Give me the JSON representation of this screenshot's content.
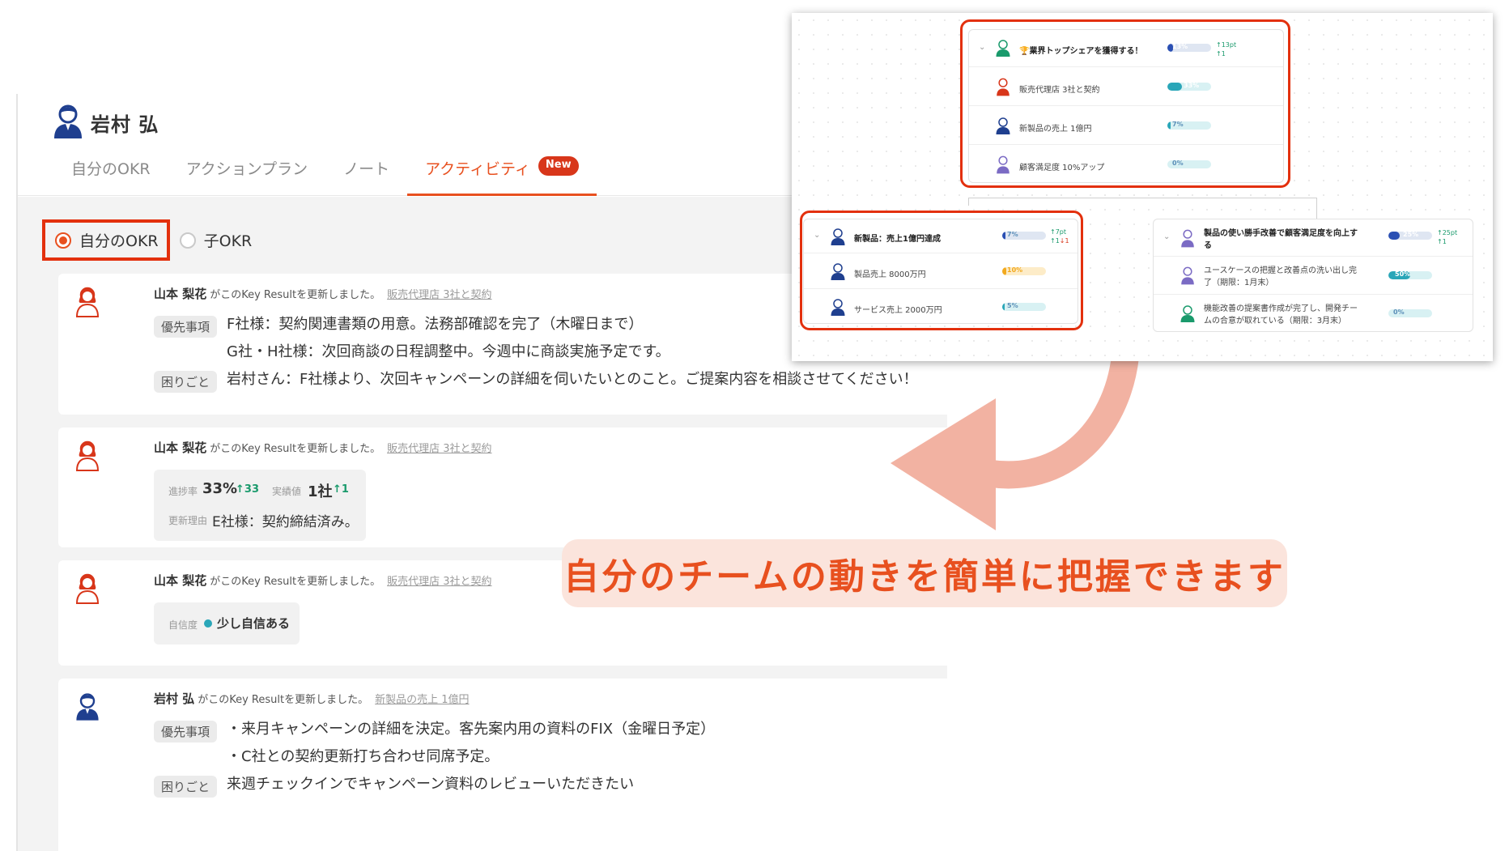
{
  "header": {
    "user_name": "岩村 弘"
  },
  "tabs": [
    {
      "label": "自分のOKR",
      "active": false
    },
    {
      "label": "アクションプラン",
      "active": false
    },
    {
      "label": "ノート",
      "active": false
    },
    {
      "label": "アクティビティ",
      "active": true,
      "badge": "New"
    }
  ],
  "filter": {
    "own_label": "自分のOKR",
    "child_label": "子OKR",
    "selected": "own"
  },
  "activity": [
    {
      "user": "山本 梨花",
      "action": "がこのKey Resultを更新しました。",
      "kr_link": "販売代理店 3社と契約",
      "tag1": "優先事項",
      "line1": "F社様：契約関連書類の用意。法務部確認を完了（木曜日まで）",
      "line2": "G社・H社様：次回商談の日程調整中。今週中に商談実施予定です。",
      "tag2": "困りごと",
      "line3": "岩村さん：F社様より、次回キャンペーンの詳細を伺いたいとのこと。ご提案内容を相談させてください！"
    },
    {
      "user": "山本 梨花",
      "action": "がこのKey Resultを更新しました。",
      "kr_link": "販売代理店 3社と契約",
      "progress_label": "進捗率",
      "progress_value": "33%",
      "progress_delta": "↑33",
      "actual_label": "実績値",
      "actual_value": "1社",
      "actual_delta": "↑1",
      "reason_label": "更新理由",
      "reason_value": "E社様：契約締結済み。"
    },
    {
      "user": "山本 梨花",
      "action": "がこのKey Resultを更新しました。",
      "kr_link": "販売代理店 3社と契約",
      "confidence_label": "自信度",
      "confidence_value": "少し自信ある"
    },
    {
      "user": "岩村 弘",
      "action": "がこのKey Resultを更新しました。",
      "kr_link": "新製品の売上 1億円",
      "tag1": "優先事項",
      "line1": "・来月キャンペーンの詳細を決定。客先案内用の資料のFIX（金曜日予定）",
      "line2": "・C社との契約更新打ち合わせ同席予定。",
      "tag2": "困りごと",
      "line3": "来週チェックインでキャンペーン資料のレビューいただきたい"
    }
  ],
  "okr_map": {
    "top": {
      "objective": "🏆業界トップシェアを獲得する！",
      "progress": "13%",
      "progress_value": 0.13,
      "delta": "↑13pt",
      "delta2": "↑1",
      "krs": [
        {
          "name": "販売代理店 3社と契約",
          "progress": "33%",
          "progress_value": 0.33
        },
        {
          "name": "新製品の売上 1億円",
          "progress": "7%",
          "progress_value": 0.07
        },
        {
          "name": "顧客満足度 10%アップ",
          "progress": "0%",
          "progress_value": 0.0
        }
      ]
    },
    "left": {
      "objective": "新製品：売上1億円達成",
      "progress": "7%",
      "progress_value": 0.07,
      "delta": "↑7pt",
      "delta2": "↑1",
      "delta3": "↓1",
      "krs": [
        {
          "name": "製品売上 8000万円",
          "progress": "10%",
          "progress_value": 0.1
        },
        {
          "name": "サービス売上 2000万円",
          "progress": "5%",
          "progress_value": 0.05
        }
      ]
    },
    "right": {
      "objective_l1": "製品の使い勝手改善で顧客満足度を向上す",
      "objective_l2": "る",
      "progress": "25%",
      "progress_value": 0.25,
      "delta": "↑25pt",
      "delta2": "↑1",
      "krs": [
        {
          "name_l1": "ユースケースの把握と改善点の洗い出し完",
          "name_l2": "了（期限：1月末）",
          "progress": "50%",
          "progress_value": 0.5
        },
        {
          "name_l1": "機能改善の提案書作成が完了し、開発チー",
          "name_l2": "ムの合意が取れている（期限：3月末）",
          "progress": "0%",
          "progress_value": 0.0
        }
      ]
    }
  },
  "caption": "自分のチームの動きを簡単に把握できます",
  "colors": {
    "accent": "#e8501f",
    "highlight": "#e3300d",
    "caption_bg": "#fbe4dc",
    "arrow": "#f2b2a2"
  }
}
